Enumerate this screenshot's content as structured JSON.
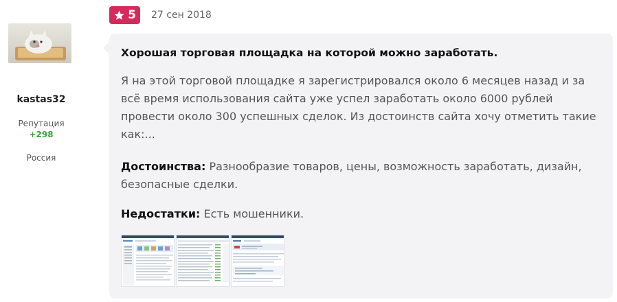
{
  "author": {
    "username": "kastas32",
    "reputation_label": "Репутация",
    "reputation_value": "+298",
    "country": "Россия"
  },
  "review": {
    "rating": "5",
    "date": "27 сен 2018",
    "title": "Хорошая торговая площадка на которой можно заработать.",
    "text": "Я на этой торговой площадке я зарегистрировался около 6 месяцев назад и за всё время использования сайта уже успел заработать около 6000 рублей провести около 300 успешных сделок. Из достоинств сайта хочу отметить такие как:...",
    "pros_label": "Достоинства:",
    "pros_text": "Разнообразие товаров, цены, возможность заработать, дизайн, безопасные сделки.",
    "cons_label": "Недостатки:",
    "cons_text": "Есть мошенники."
  },
  "icons": {
    "rating": "star-icon",
    "avatar": "cat-photo",
    "attachments": "screenshot-thumbnail"
  },
  "colors": {
    "rating_badge": "#d52b5b",
    "reputation": "#3ca33c",
    "bubble_bg": "#f3f3f5"
  }
}
